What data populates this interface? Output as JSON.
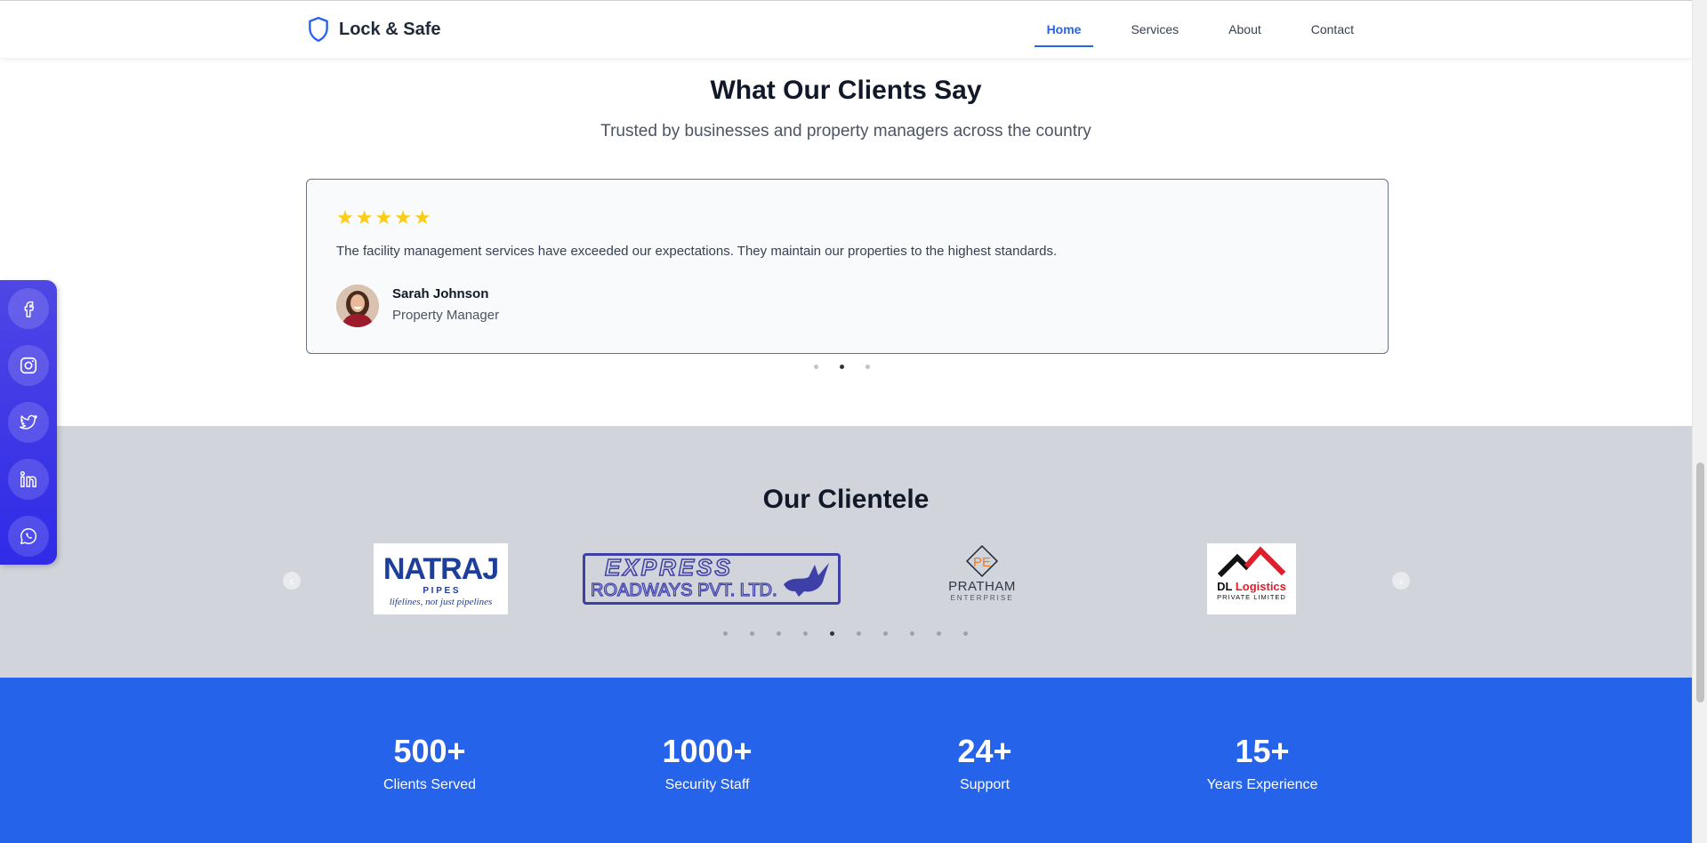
{
  "header": {
    "brand": "Lock & Safe",
    "nav": [
      {
        "label": "Home",
        "active": true
      },
      {
        "label": "Services",
        "active": false
      },
      {
        "label": "About",
        "active": false
      },
      {
        "label": "Contact",
        "active": false
      }
    ]
  },
  "testimonials": {
    "title": "What Our Clients Say",
    "subtitle": "Trusted by businesses and property managers across the country",
    "rating": 5,
    "quote": "The facility management services have exceeded our expectations. They maintain our properties to the highest standards.",
    "author_name": "Sarah Johnson",
    "author_role": "Property Manager",
    "slides": 3,
    "active_slide": 2
  },
  "clientele": {
    "title": "Our Clientele",
    "logos": {
      "natraj": {
        "main": "NATRAJ",
        "sub": "P I P E S",
        "tag": "lifelines, not just pipelines"
      },
      "express": {
        "main": "EXPRESS",
        "sub": "ROADWAYS PVT. LTD."
      },
      "pratham": {
        "main": "PRATHAM",
        "sub": "ENTERPRISE",
        "mark": "PE"
      },
      "dl": {
        "main1": "DL",
        "main2": "Logistics",
        "sub": "PRIVATE LIMITED"
      }
    },
    "slides": 10,
    "active_slide": 5
  },
  "stats": [
    {
      "value": "500+",
      "label": "Clients Served"
    },
    {
      "value": "1000+",
      "label": "Security Staff"
    },
    {
      "value": "24+",
      "label": "Support"
    },
    {
      "value": "15+",
      "label": "Years Experience"
    }
  ],
  "social": [
    "facebook-icon",
    "instagram-icon",
    "twitter-icon",
    "linkedin-icon",
    "whatsapp-icon"
  ],
  "colors": {
    "accent": "#2563eb",
    "star": "#facc15",
    "clientele_bg": "#d1d5db",
    "social_bg": "#4f46e5"
  }
}
